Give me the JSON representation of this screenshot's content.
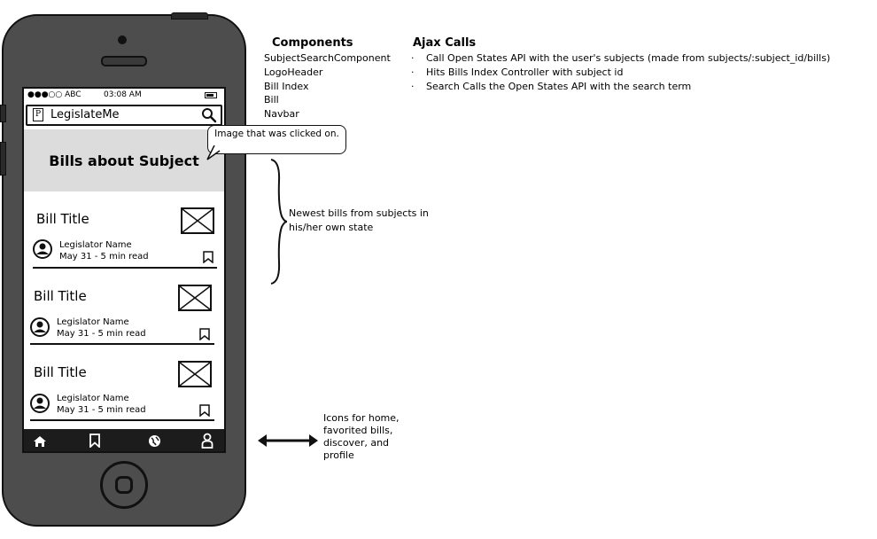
{
  "phone": {
    "status_bar": {
      "signal": "●●●○○ ABC",
      "time": "03:08 AM"
    },
    "header": {
      "title": "LegislateMe",
      "logo_letter": "P"
    },
    "banner": {
      "title": "Bills about Subject"
    },
    "bills": [
      {
        "title": "Bill Title",
        "legislator": "Legislator Name",
        "meta": "May 31 - 5 min read"
      },
      {
        "title": "Bill Title",
        "legislator": "Legislator Name",
        "meta": "May 31 - 5 min read"
      },
      {
        "title": "Bill Title",
        "legislator": "Legislator Name",
        "meta": "May 31 - 5 min read"
      }
    ],
    "navbar": {
      "icons": [
        "home-icon",
        "bookmark-icon",
        "globe-icon",
        "user-icon"
      ]
    }
  },
  "callout": {
    "text": "Image that was clicked on."
  },
  "components": {
    "heading": "Components",
    "items": [
      "SubjectSearchComponent",
      "LogoHeader",
      "Bill Index",
      "Bill",
      "Navbar"
    ]
  },
  "ajax": {
    "heading": "Ajax Calls",
    "bullet": "·",
    "items": [
      "Call Open States API with the user's subjects (made from subjects/:subject_id/bills)",
      "Hits Bills Index Controller with subject id",
      "Search Calls the Open States API with the search term"
    ]
  },
  "annotations": {
    "newest_bills": "Newest bills from subjects in his/her own state",
    "icons_note": "Icons for home, favorited bills, discover, and profile"
  }
}
